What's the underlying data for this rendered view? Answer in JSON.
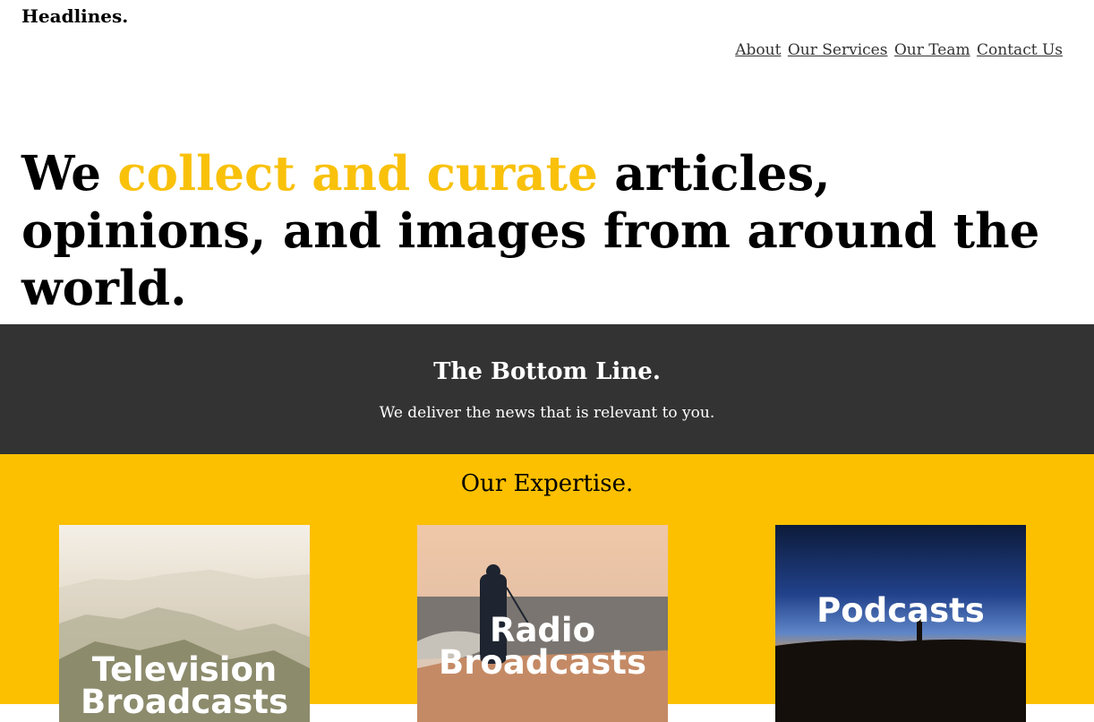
{
  "header": {
    "logo": "Headlines.",
    "nav": [
      "About",
      "Our Services",
      "Our Team",
      "Contact Us"
    ]
  },
  "hero": {
    "prefix": "We ",
    "accent": "collect and curate",
    "suffix": " articles, opinions, and images from around the world."
  },
  "bottom_line": {
    "title": "The Bottom Line.",
    "text": "We deliver the news that is relevant to you."
  },
  "expertise": {
    "title": "Our Expertise.",
    "cards": [
      {
        "label": "Television Broadcasts"
      },
      {
        "label": "Radio Broadcasts"
      },
      {
        "label": "Podcasts"
      }
    ]
  },
  "colors": {
    "accent": "#f9c10a",
    "dark_band": "#333333",
    "yellow_band": "#fcc000"
  }
}
